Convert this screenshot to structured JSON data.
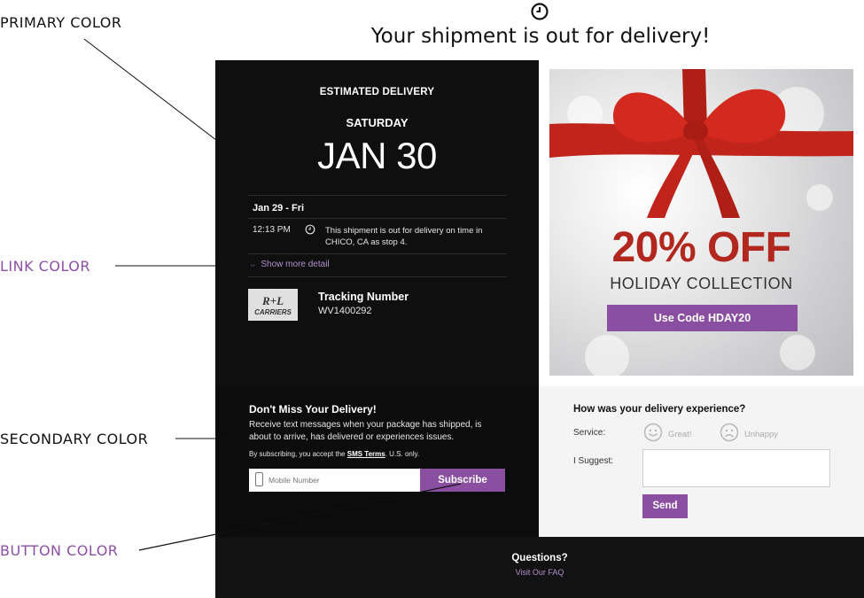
{
  "annotations": {
    "primary": "PRIMARY COLOR",
    "link": "LINK COLOR",
    "secondary": "SECONDARY COLOR",
    "button": "BUTTON COLOR"
  },
  "header": {
    "icon": "clock-icon",
    "title": "Your shipment is out for delivery!"
  },
  "delivery": {
    "label": "ESTIMATED DELIVERY",
    "day": "SATURDAY",
    "date": "JAN 30"
  },
  "events": [
    {
      "date": "Jan 29 - Fri",
      "time": "12:13 PM",
      "icon": "clock-icon",
      "description": "This shipment is out for delivery on time in CHICO, CA as stop 4."
    }
  ],
  "show_more": "Show more detail",
  "tracking": {
    "carrier_logo_text": "R+L CARRIERS",
    "label": "Tracking Number",
    "number": "WV1400292"
  },
  "promo": {
    "headline": "20% OFF",
    "subhead": "HOLIDAY COLLECTION",
    "button": "Use Code HDAY20"
  },
  "sms": {
    "title": "Don't Miss Your Delivery!",
    "body": "Receive text messages when your package has shipped, is about to arrive, has delivered or experiences issues.",
    "terms_prefix": "By subscribing, you accept the",
    "terms_link": "SMS Terms",
    "terms_suffix": ". U.S. only.",
    "input_placeholder": "Mobile Number",
    "button": "Subscribe"
  },
  "feedback": {
    "title": "How was your delivery experience?",
    "service_label": "Service:",
    "great": "Great!",
    "unhappy": "Unhappy",
    "suggest_label": "I Suggest:",
    "send": "Send"
  },
  "footer": {
    "title": "Questions?",
    "link": "Visit Our FAQ"
  },
  "colors": {
    "primary": "#0f0f10",
    "link": "#b58fd0",
    "secondary": "#0c0c0c",
    "button": "#8a4fa1",
    "promo_red": "#b2281f"
  }
}
